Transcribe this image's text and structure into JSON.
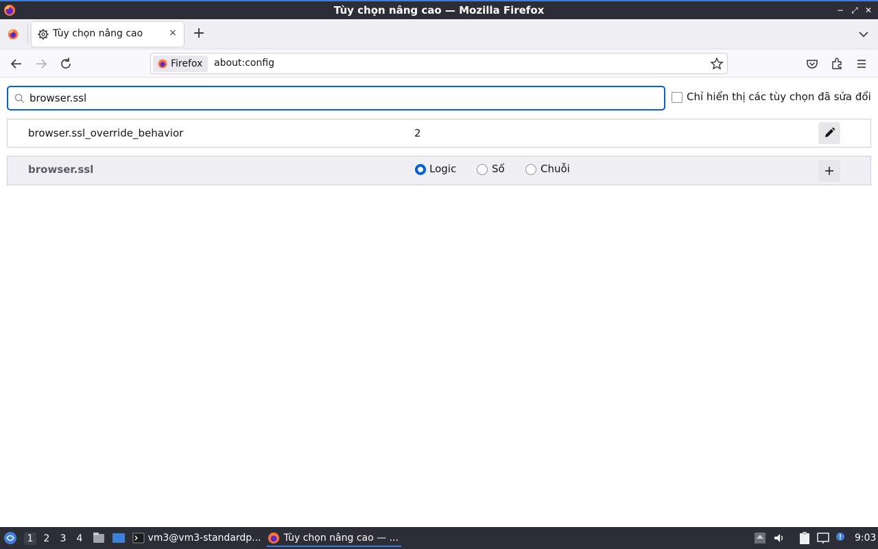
{
  "window": {
    "title": "Tùy chọn nâng cao — Mozilla Firefox",
    "minimize_glyph": "−",
    "maximize_glyph": "⤢",
    "close_glyph": "✕"
  },
  "tabs": [
    {
      "label": "Tùy chọn nâng cao",
      "icon": "gear-icon",
      "active": true
    }
  ],
  "tabbar": {
    "new_tab_glyph": "+",
    "close_glyph": "×"
  },
  "navbar": {
    "identity_label": "Firefox",
    "url": "about:config"
  },
  "config": {
    "search_value": "browser.ssl",
    "modified_only_label": "Chỉ hiển thị các tùy chọn đã sửa đổi",
    "modified_only_checked": false,
    "rows": [
      {
        "name": "browser.ssl_override_behavior",
        "value": "2",
        "action": "edit-icon"
      },
      {
        "name": "browser.ssl",
        "new": true,
        "types": [
          "Logic",
          "Số",
          "Chuỗi"
        ],
        "selected_type": "Logic",
        "action": "add-icon"
      }
    ]
  },
  "taskbar": {
    "workspaces": [
      "1",
      "2",
      "3",
      "4"
    ],
    "active_workspace": "1",
    "tasks": [
      {
        "label": "vm3@vm3-standardp...",
        "icon": "terminal-icon"
      },
      {
        "label": "Tùy chọn nâng cao — ...",
        "icon": "firefox-icon",
        "active": true
      }
    ],
    "clock": "9:03"
  },
  "colors": {
    "accent": "#0061e0",
    "titlebar": "#2b2e37",
    "focus_line": "#3d7fd9"
  }
}
